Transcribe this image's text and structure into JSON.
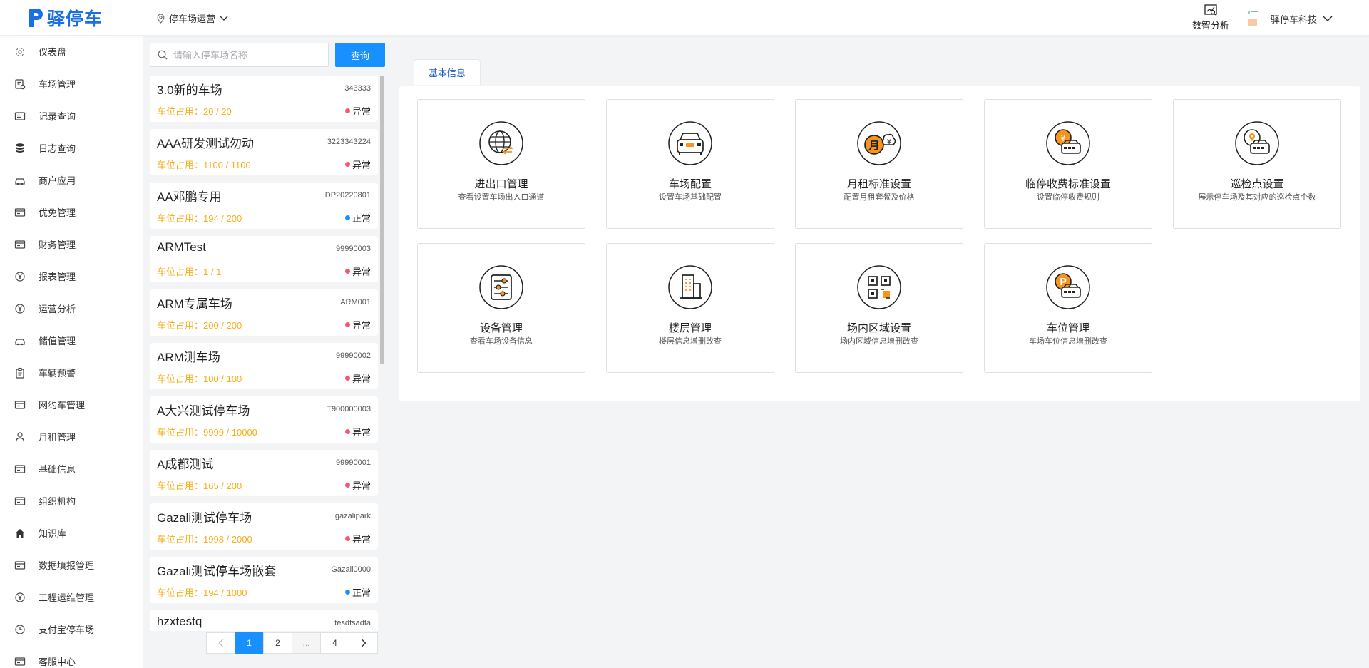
{
  "app": {
    "name": "驿停车"
  },
  "header": {
    "location": "停车场运营",
    "analytics": "数智分析",
    "company": "驿停车科技"
  },
  "sidebar": {
    "items": [
      {
        "label": "仪表盘",
        "icon": "dashboard-icon"
      },
      {
        "label": "车场管理",
        "icon": "parking-manage-icon"
      },
      {
        "label": "记录查询",
        "icon": "record-icon"
      },
      {
        "label": "日志查询",
        "icon": "database-icon"
      },
      {
        "label": "商户应用",
        "icon": "car-icon"
      },
      {
        "label": "优免管理",
        "icon": "card-icon"
      },
      {
        "label": "财务管理",
        "icon": "card-icon"
      },
      {
        "label": "报表管理",
        "icon": "yen-icon"
      },
      {
        "label": "运营分析",
        "icon": "yen-icon"
      },
      {
        "label": "储值管理",
        "icon": "car-icon"
      },
      {
        "label": "车辆预警",
        "icon": "clipboard-icon"
      },
      {
        "label": "网约车管理",
        "icon": "card-icon"
      },
      {
        "label": "月租管理",
        "icon": "user-icon"
      },
      {
        "label": "基础信息",
        "icon": "card-icon"
      },
      {
        "label": "组织机构",
        "icon": "card-icon"
      },
      {
        "label": "知识库",
        "icon": "home-icon"
      },
      {
        "label": "数据填报管理",
        "icon": "card-icon"
      },
      {
        "label": "工程运维管理",
        "icon": "yen-icon"
      },
      {
        "label": "支付宝停车场",
        "icon": "clock-icon"
      },
      {
        "label": "客服中心",
        "icon": "card-icon"
      }
    ]
  },
  "search": {
    "placeholder": "请输入停车场名称",
    "button": "查询"
  },
  "parking_lots": [
    {
      "name": "3.0新的车场",
      "code": "343333",
      "usage": "车位占用：20 / 20",
      "status": "异常",
      "status_color": "#f5576c"
    },
    {
      "name": "AAA研发测试勿动",
      "code": "3223343224",
      "usage": "车位占用：1100 / 1100",
      "status": "异常",
      "status_color": "#f5576c"
    },
    {
      "name": "AA邓鹏专用",
      "code": "DP20220801",
      "usage": "车位占用：194 / 200",
      "status": "正常",
      "status_color": "#1890ff"
    },
    {
      "name": "ARMTest",
      "code": "99990003",
      "usage": "车位占用：1 / 1",
      "status": "异常",
      "status_color": "#f5576c"
    },
    {
      "name": "ARM专属车场",
      "code": "ARM001",
      "usage": "车位占用：200 / 200",
      "status": "异常",
      "status_color": "#f5576c"
    },
    {
      "name": "ARM测车场",
      "code": "99990002",
      "usage": "车位占用：100 / 100",
      "status": "异常",
      "status_color": "#f5576c"
    },
    {
      "name": "A大兴测试停车场",
      "code": "T900000003",
      "usage": "车位占用：9999 / 10000",
      "status": "异常",
      "status_color": "#f5576c"
    },
    {
      "name": "A成都测试",
      "code": "99990001",
      "usage": "车位占用：165 / 200",
      "status": "异常",
      "status_color": "#f5576c"
    },
    {
      "name": "Gazali测试停车场",
      "code": "gazalipark",
      "usage": "车位占用：1998 / 2000",
      "status": "异常",
      "status_color": "#f5576c"
    },
    {
      "name": "Gazali测试停车场嵌套",
      "code": "Gazali0000",
      "usage": "车位占用：194 / 1000",
      "status": "正常",
      "status_color": "#1890ff"
    },
    {
      "name": "hzxtestq",
      "code": "tesdfsadfa",
      "usage": "",
      "status": "",
      "status_color": ""
    }
  ],
  "pagination": {
    "pages": [
      "1",
      "2",
      "...",
      "4"
    ],
    "current": "1"
  },
  "tab": {
    "label": "基本信息"
  },
  "features": [
    {
      "title": "进出口管理",
      "desc": "查看设置车场出入口通道",
      "icon": "globe-exchange-icon"
    },
    {
      "title": "车场配置",
      "desc": "设置车场基础配置",
      "icon": "car-front-icon"
    },
    {
      "title": "月租标准设置",
      "desc": "配置月租套餐及价格",
      "icon": "monthly-rent-icon"
    },
    {
      "title": "临停收费标准设置",
      "desc": "设置临停收费规则",
      "icon": "temp-fee-icon"
    },
    {
      "title": "巡检点设置",
      "desc": "展示停车场及其对应的巡检点个数",
      "icon": "inspection-point-icon"
    },
    {
      "title": "设备管理",
      "desc": "查看车场设备信息",
      "icon": "device-sliders-icon"
    },
    {
      "title": "楼层管理",
      "desc": "楼层信息增删改查",
      "icon": "building-icon"
    },
    {
      "title": "场内区域设置",
      "desc": "场内区域信息增删改查",
      "icon": "qr-area-icon"
    },
    {
      "title": "车位管理",
      "desc": "车场车位信息增删改查",
      "icon": "parking-space-icon"
    }
  ],
  "colors": {
    "accent": "#1890ff",
    "brand": "#1a6fe3",
    "warning": "#faad14",
    "error": "#f5576c",
    "icon_orange": "#f7941d"
  }
}
